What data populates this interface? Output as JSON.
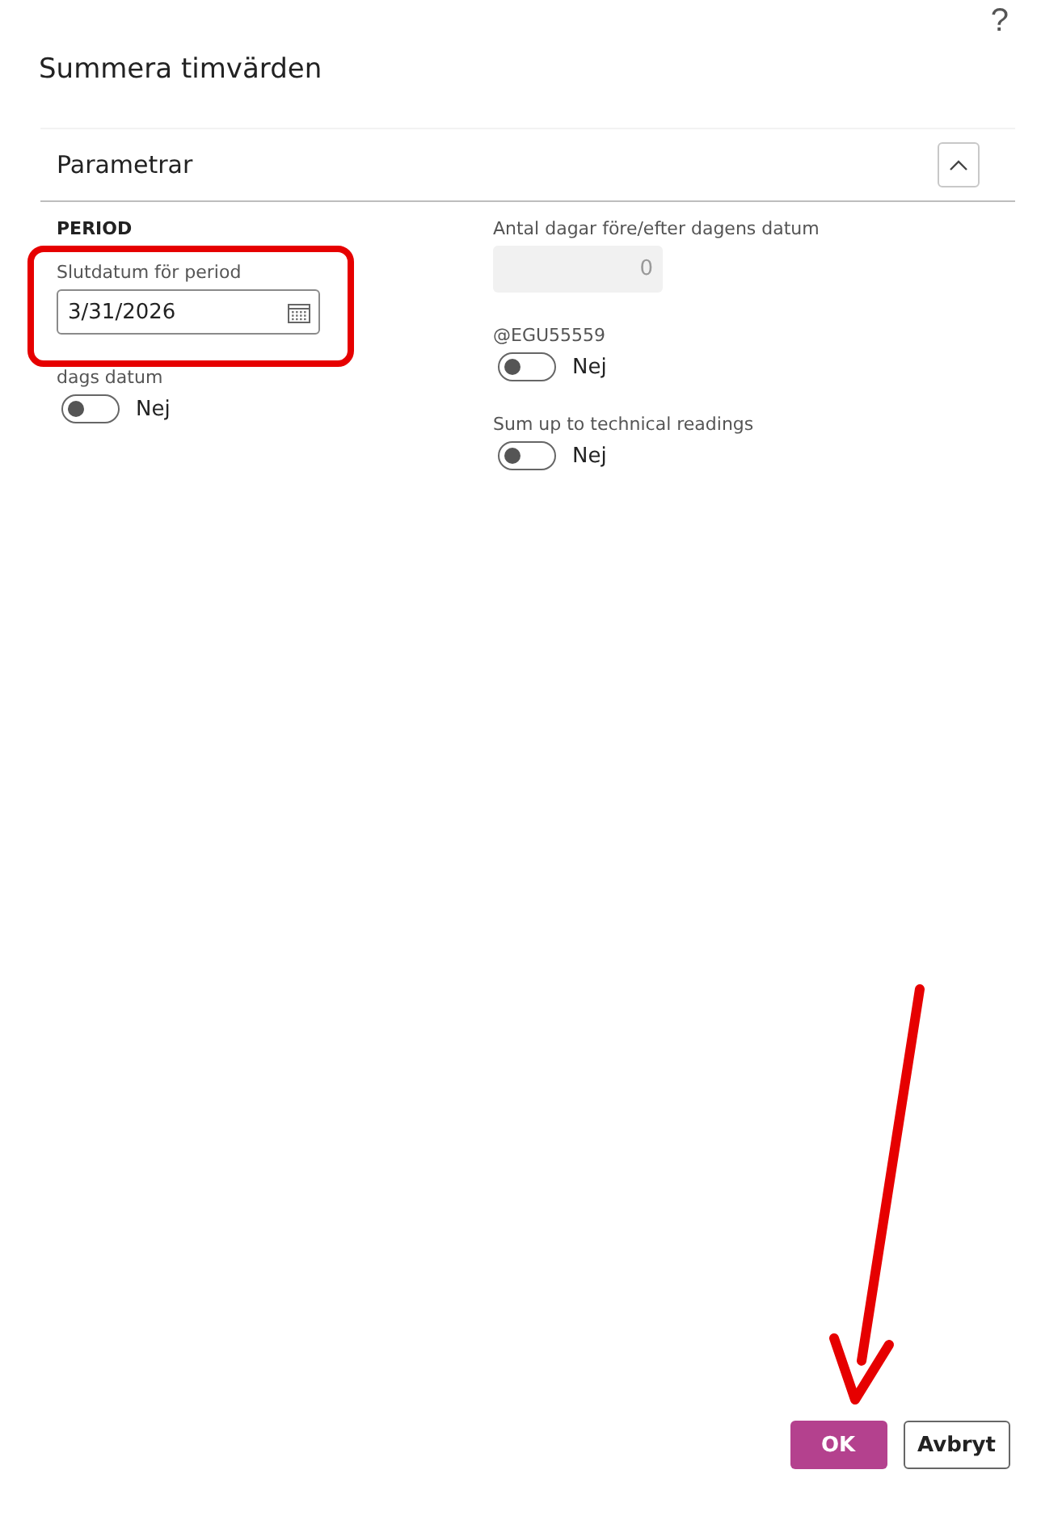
{
  "help": "?",
  "title": "Summera timvärden",
  "section": {
    "title": "Parametrar",
    "expanded": true
  },
  "left": {
    "group": "PERIOD",
    "fields": [
      {
        "kind": "date",
        "label": "Slutdatum för period",
        "value": "3/31/2026",
        "highlighted": true
      },
      {
        "kind": "toggle",
        "label": "dags datum",
        "on": false,
        "state_text": "Nej"
      }
    ]
  },
  "right": {
    "fields": [
      {
        "kind": "number",
        "label": "Antal dagar före/efter dagens datum",
        "value": "0",
        "disabled": true
      },
      {
        "kind": "toggle",
        "label": "@EGU55559",
        "on": false,
        "state_text": "Nej"
      },
      {
        "kind": "toggle",
        "label": "Sum up to technical readings",
        "on": false,
        "state_text": "Nej"
      }
    ]
  },
  "buttons": [
    {
      "label": "OK",
      "primary": true
    },
    {
      "label": "Avbryt",
      "primary": false
    }
  ],
  "annotation": {
    "arrow": true
  }
}
